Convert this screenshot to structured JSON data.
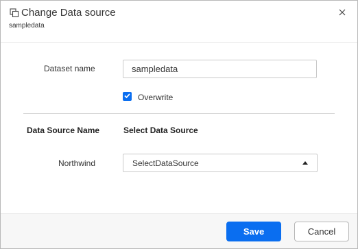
{
  "dialog": {
    "title": "Change Data source",
    "subtitle": "sampledata",
    "title_icon": "copy-icon",
    "close_icon": "close-icon"
  },
  "form": {
    "dataset_label": "Dataset name",
    "dataset_value": "sampledata",
    "overwrite_label": "Overwrite",
    "overwrite_checked": true,
    "col_header_name": "Data Source Name",
    "col_header_select": "Select Data Source",
    "row_name": "Northwind",
    "row_select_value": "SelectDataSource"
  },
  "footer": {
    "save_label": "Save",
    "cancel_label": "Cancel"
  },
  "colors": {
    "accent": "#0a6ef0",
    "footer_bg": "#f7f7f7"
  }
}
